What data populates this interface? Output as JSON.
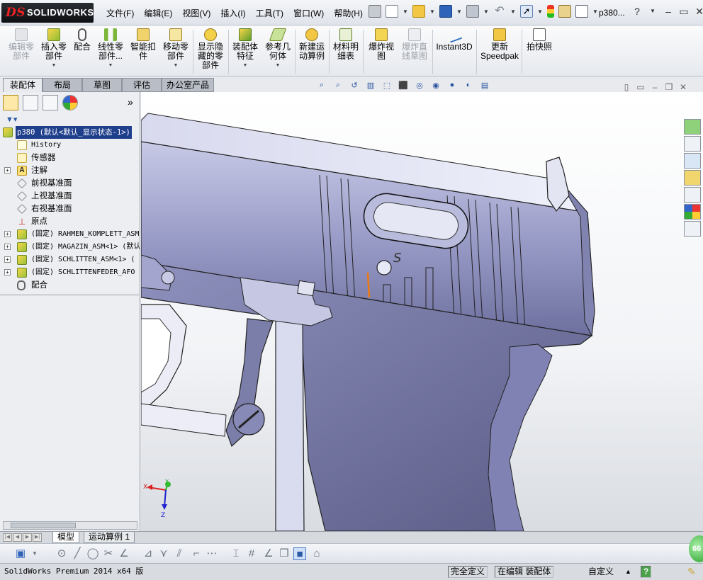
{
  "app": {
    "logo_text": "SOLIDWORKS",
    "logo_mark": "DS",
    "document_name": "p380..."
  },
  "menu": [
    "文件(F)",
    "编辑(E)",
    "视图(V)",
    "插入(I)",
    "工具(T)",
    "窗口(W)",
    "帮助(H)"
  ],
  "command_manager": {
    "items": [
      {
        "label": "编辑零\n部件",
        "disabled": true
      },
      {
        "label": "插入零\n部件",
        "disabled": false
      },
      {
        "label": "配合",
        "disabled": false
      },
      {
        "label": "线性零\n部件...",
        "disabled": false
      },
      {
        "label": "智能扣\n件",
        "disabled": false
      },
      {
        "label": "移动零\n部件",
        "disabled": false
      },
      {
        "label": "显示隐\n藏的零\n部件",
        "disabled": false
      },
      {
        "label": "装配体\n特征",
        "disabled": false
      },
      {
        "label": "参考几\n何体",
        "disabled": false
      },
      {
        "label": "新建运\n动算例",
        "disabled": false
      },
      {
        "label": "材料明\n细表",
        "disabled": false
      },
      {
        "label": "爆炸视\n图",
        "disabled": false
      },
      {
        "label": "爆炸直\n线草图",
        "disabled": true
      },
      {
        "label": "Instant3D",
        "disabled": false
      },
      {
        "label": "更新\nSpeedpak",
        "disabled": false
      },
      {
        "label": "拍快照",
        "disabled": false
      }
    ]
  },
  "tabs": [
    "装配体",
    "布局",
    "草图",
    "评估",
    "办公室产品"
  ],
  "feature_tree": {
    "root": "p380 (默认<默认_显示状态-1>)",
    "items": [
      {
        "label": "History",
        "icon": "history-icon",
        "mono": true
      },
      {
        "label": "传感器",
        "icon": "sensor-icon"
      },
      {
        "label": "注解",
        "icon": "annotation-icon",
        "expandable": true
      },
      {
        "label": "前视基准面",
        "icon": "plane-icon"
      },
      {
        "label": "上视基准面",
        "icon": "plane-icon"
      },
      {
        "label": "右视基准面",
        "icon": "plane-icon"
      },
      {
        "label": "原点",
        "icon": "origin-icon"
      },
      {
        "label": "(固定) RAHMEN_KOMPLETT_ASM",
        "icon": "assembly-icon",
        "expandable": true,
        "mono": true
      },
      {
        "label": "(固定) MAGAZIN_ASM<1> (默认",
        "icon": "assembly-icon",
        "expandable": true,
        "mono": true
      },
      {
        "label": "(固定) SCHLITTEN_ASM<1> (",
        "icon": "assembly-icon",
        "expandable": true,
        "mono": true
      },
      {
        "label": "(固定) SCHLITTENFEDER_AFO",
        "icon": "assembly-icon",
        "expandable": true,
        "mono": true
      },
      {
        "label": "配合",
        "icon": "mate-icon"
      }
    ]
  },
  "graphics": {
    "slide_letter": "S",
    "triad": {
      "x": "X",
      "y": "Y",
      "z": "Z"
    }
  },
  "bottom_tabs": [
    "模型",
    "运动算例 1"
  ],
  "status_bar": {
    "product": "SolidWorks Premium 2014 x64 版",
    "definition": "完全定义",
    "editing": "在编辑 装配体",
    "units": "自定义",
    "help": "?"
  },
  "badge": "66"
}
